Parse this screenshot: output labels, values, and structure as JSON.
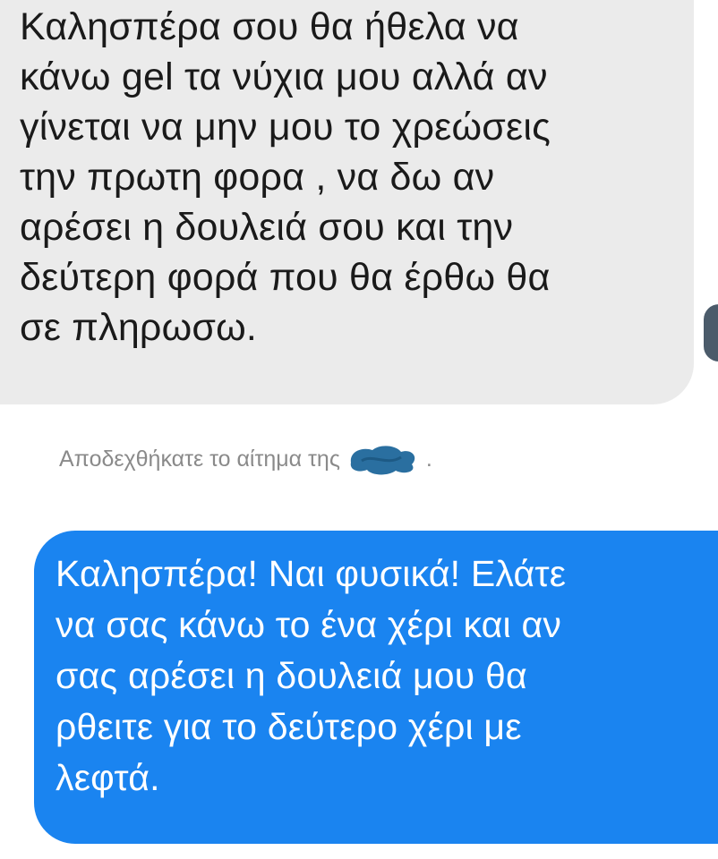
{
  "incoming_message": {
    "lines": [
      "Καλησπέρα σου θα ήθελα να",
      "κάνω gel τα νύχια μου αλλά αν",
      "γίνεται να μην μου το χρεώσεις",
      "την πρωτη φορα , να δω αν",
      "αρέσει η δουλειά σου και την",
      "δεύτερη φορά που θα έρθω θα",
      "σε πληρωσω."
    ]
  },
  "system_note": {
    "text": "Αποδεχθήκατε το αίτημα της",
    "suffix": "."
  },
  "outgoing_message": {
    "lines": [
      "Καλησπέρα! Ναι φυσικά! Ελάτε",
      "να σας κάνω το ένα χέρι και αν",
      "σας αρέσει η δουλειά μου θα",
      "ρθειτε για το δεύτερο χέρι με",
      "λεφτά."
    ]
  },
  "colors": {
    "incoming_bg": "#ebebeb",
    "outgoing_bg": "#1a84f0",
    "system_text": "#8a8a8a",
    "scribble": "#2a6fa0"
  },
  "icons": {
    "redaction": "scribble-redaction-icon",
    "avatar": "avatar-icon"
  }
}
